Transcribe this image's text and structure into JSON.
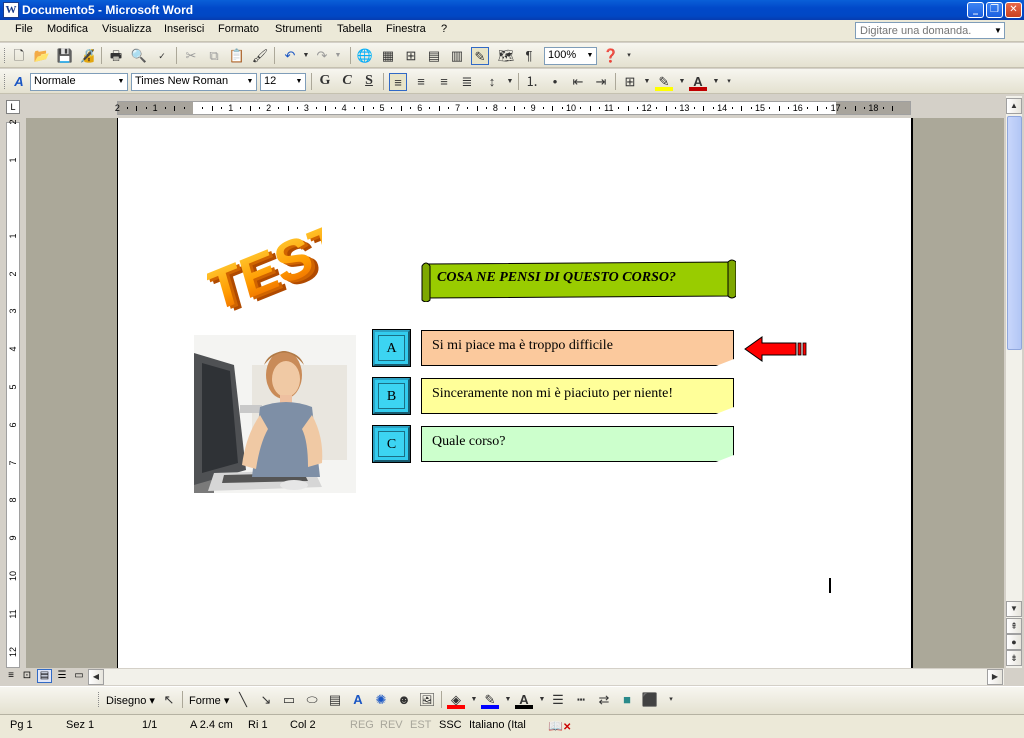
{
  "window": {
    "app_icon": "W",
    "title": "Documento5 - Microsoft Word",
    "minimize": "_",
    "restore": "❐",
    "close": "✕"
  },
  "menu": {
    "items": [
      "File",
      "Modifica",
      "Visualizza",
      "Inserisci",
      "Formato",
      "Strumenti",
      "Tabella",
      "Finestra",
      "?"
    ],
    "ask_placeholder": "Digitare una domanda."
  },
  "standard_toolbar": {
    "zoom": "100%"
  },
  "formatting_toolbar": {
    "style": "Normale",
    "font": "Times New Roman",
    "size": "12",
    "bold": "G",
    "italic": "C",
    "underline": "S"
  },
  "ruler": {
    "labels": [
      "2",
      "1",
      "1",
      "2",
      "3",
      "4",
      "5",
      "6",
      "7",
      "8",
      "9",
      "10",
      "11",
      "12",
      "13",
      "14",
      "15",
      "16",
      "17",
      "18"
    ],
    "vlabels": [
      "2",
      "1",
      "1",
      "2",
      "3",
      "4",
      "5",
      "6",
      "7",
      "8",
      "9",
      "10",
      "11",
      "12"
    ]
  },
  "document": {
    "wordart": "TEST",
    "question": "COSA NE PENSI DI QUESTO CORSO?",
    "answers": [
      {
        "letter": "A",
        "text": "Si mi piace ma è troppo difficile",
        "color": "#fbc99d"
      },
      {
        "letter": "B",
        "text": "Sinceramente non mi è piaciuto per niente!",
        "color": "#ffff99"
      },
      {
        "letter": "C",
        "text": "Quale corso?",
        "color": "#ccffcc"
      }
    ]
  },
  "drawing_toolbar": {
    "draw_menu": "Disegno",
    "shapes_menu": "Forme"
  },
  "status": {
    "page": "Pg 1",
    "section": "Sez 1",
    "pages": "1/1",
    "at": "A 2.4 cm",
    "line": "Ri 1",
    "col": "Col 2",
    "rec": "REG",
    "rev": "REV",
    "ext": "EST",
    "ovr": "SSC",
    "lang": "Italiano (Ital"
  }
}
